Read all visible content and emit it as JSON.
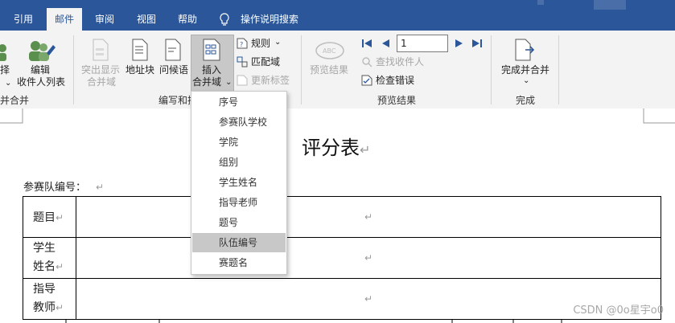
{
  "tabs": [
    "引用",
    "邮件",
    "审阅",
    "视图",
    "帮助"
  ],
  "tell_me": "操作说明搜索",
  "ribbon": {
    "partial_select": "择",
    "edit_recipients": [
      "编辑",
      "收件人列表"
    ],
    "start_merge_partial": "并合并",
    "highlight_fields": [
      "突出显示",
      "合并域"
    ],
    "address_block": "地址块",
    "greeting_line": "问候语",
    "insert_merge_field": [
      "插入",
      "合并域"
    ],
    "rules": "规则",
    "match_fields": "匹配域",
    "update_labels": "更新标签",
    "write_insert_partial": "编写和插",
    "preview_results": "预览结果",
    "record_value": "1",
    "find_recipient": "查找收件人",
    "check_errors": "检查错误",
    "preview_group": "预览结果",
    "finish_merge": "完成并合并",
    "finish_group": "完成"
  },
  "dropdown_items": [
    "序号",
    "参赛队学校",
    "学院",
    "组别",
    "学生姓名",
    "指导老师",
    "题号",
    "队伍编号",
    "赛题名"
  ],
  "dropdown_selected": "队伍编号",
  "document": {
    "title": "评分表",
    "team_label": "参赛队编号：",
    "rows": [
      {
        "label": "题目"
      },
      {
        "label1": "学生",
        "label2": "姓名"
      },
      {
        "label1": "指导",
        "label2": "教师"
      }
    ],
    "para_mark": "↵"
  },
  "watermark": "CSDN @0o星宇o0",
  "colors": {
    "tab_bar": "#2b579a",
    "ribbon_bg": "#f3f3f3",
    "accent_blue": "#2b579a"
  }
}
